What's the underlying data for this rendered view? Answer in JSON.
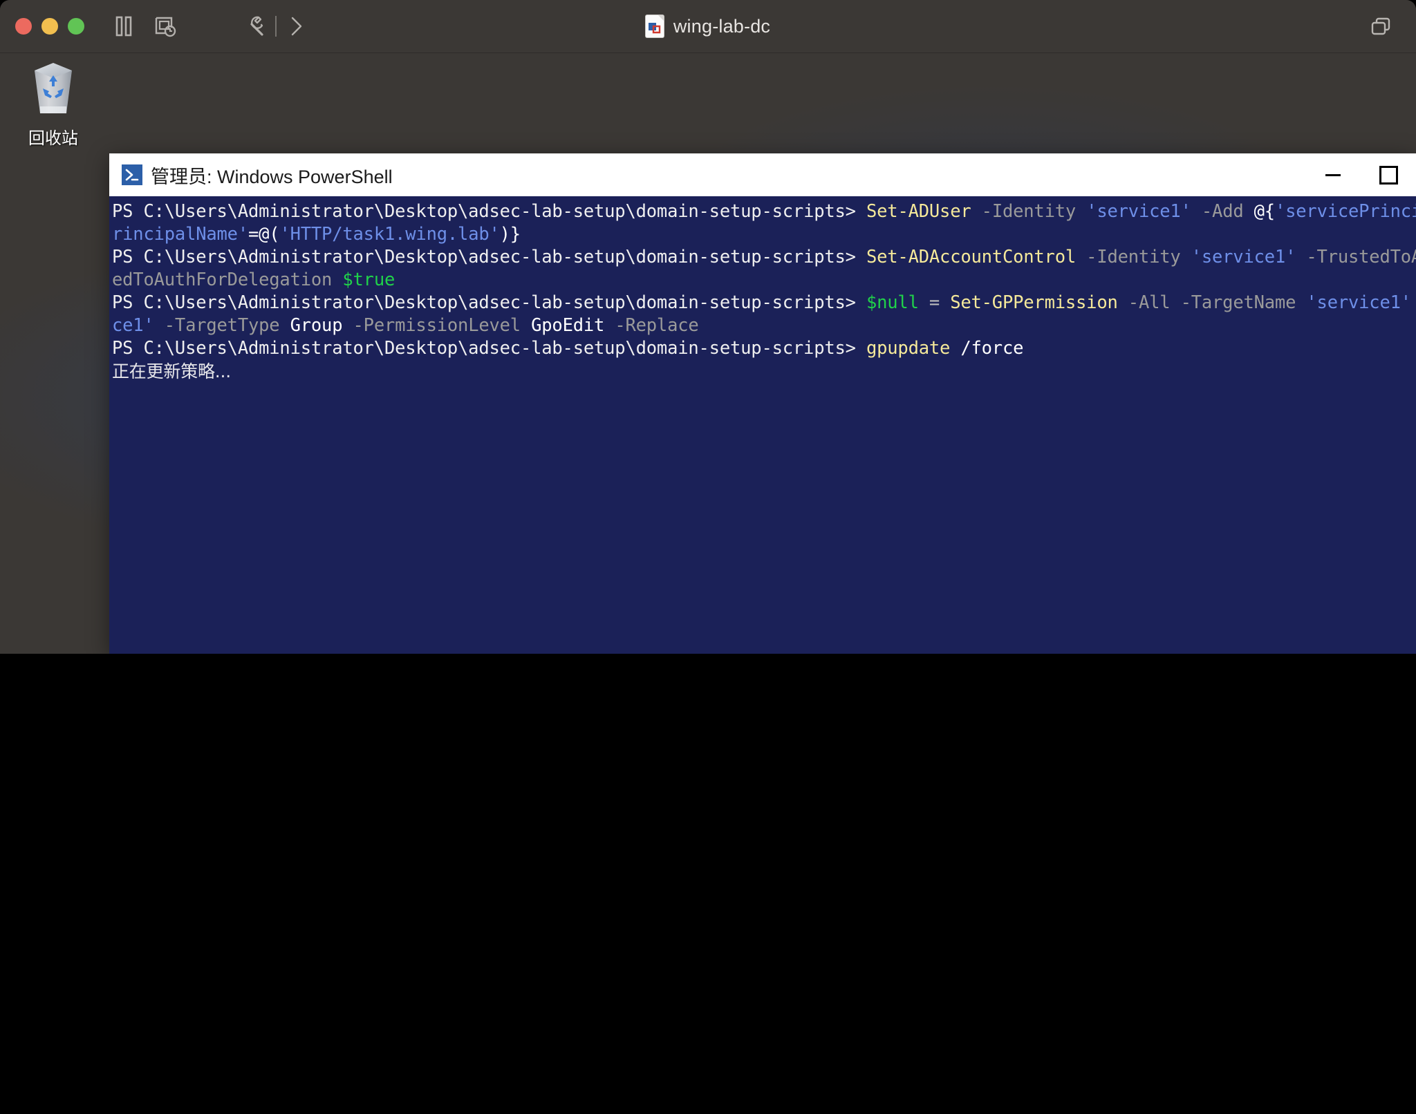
{
  "client": {
    "title": "wing-lab-dc",
    "title_icon": "rdp-file-icon",
    "traffic_lights": [
      "close-button",
      "minimize-button",
      "zoom-button"
    ],
    "toolbar_icons": [
      {
        "name": "pause-icon",
        "label": "Pause"
      },
      {
        "name": "screenshot-clock-icon",
        "label": "Capture"
      },
      {
        "name": "wrench-icon",
        "label": "Tools"
      },
      {
        "name": "chevron-right-icon",
        "label": "Expand"
      }
    ],
    "restore_icon": "restore-windows-icon"
  },
  "desktop": {
    "icons": [
      {
        "name": "recycle-bin",
        "label": "回收站"
      }
    ]
  },
  "powershell": {
    "title": "管理员: Windows PowerShell",
    "icon": "powershell-prompt-icon",
    "controls": {
      "minimize": "minimize-button",
      "maximize": "maximize-button"
    },
    "prompt": "PS C:\\Users\\Administrator\\Desktop\\adsec-lab-setup\\domain-setup-scripts> ",
    "lines": [
      {
        "id": "line-1",
        "segments": [
          {
            "t": "PS C:\\Users\\Administrator\\Desktop\\adsec-lab-setup\\domain-se",
            "c": "tok-path"
          },
          {
            "t": "tup-scripts> ",
            "c": "tok-path"
          },
          {
            "t": "Set-ADUser ",
            "c": "tok-cmdlet"
          },
          {
            "t": "-Identity ",
            "c": "tok-param"
          },
          {
            "t": "'service1'",
            "c": "tok-string"
          },
          {
            "t": " ",
            "c": "tok-plain"
          },
          {
            "t": "-Add ",
            "c": "tok-param"
          },
          {
            "t": "@{",
            "c": "tok-plain"
          },
          {
            "t": "'servicePrincipalName'",
            "c": "tok-string"
          }
        ]
      },
      {
        "id": "line-2",
        "segments": [
          {
            "t": "rincipalName'",
            "c": "tok-string"
          },
          {
            "t": "=@(",
            "c": "tok-plain"
          },
          {
            "t": "'HTTP/task1.wing.lab'",
            "c": "tok-string"
          },
          {
            "t": ")}",
            "c": "tok-plain"
          }
        ]
      },
      {
        "id": "line-3",
        "segments": [
          {
            "t": "PS C:\\Users\\Administrator\\Desktop\\adsec-lab-setup\\domain-setup-scrip",
            "c": "tok-path"
          },
          {
            "t": "ts> ",
            "c": "tok-path"
          },
          {
            "t": "Set-ADAccountControl ",
            "c": "tok-cmdlet"
          },
          {
            "t": "-Identity ",
            "c": "tok-param"
          },
          {
            "t": "'service1'",
            "c": "tok-string"
          },
          {
            "t": " ",
            "c": "tok-plain"
          },
          {
            "t": "-TrustedToAuthForDelegation",
            "c": "tok-param"
          }
        ]
      },
      {
        "id": "line-4",
        "segments": [
          {
            "t": "edToAuthForDelegation ",
            "c": "tok-param"
          },
          {
            "t": "$true",
            "c": "tok-var"
          }
        ]
      },
      {
        "id": "line-5",
        "segments": [
          {
            "t": "PS C:\\Users\\Administrator\\Desktop\\adsec-lab-setup\\domain-setup-scrip",
            "c": "tok-path"
          },
          {
            "t": "ts> ",
            "c": "tok-path"
          },
          {
            "t": "$null",
            "c": "tok-var"
          },
          {
            "t": " = ",
            "c": "tok-op"
          },
          {
            "t": "Set-GPPermission ",
            "c": "tok-cmdlet"
          },
          {
            "t": "-All ",
            "c": "tok-param"
          },
          {
            "t": "-TargetName ",
            "c": "tok-param"
          },
          {
            "t": "'service1'",
            "c": "tok-string"
          }
        ]
      },
      {
        "id": "line-6",
        "segments": [
          {
            "t": "ce1'",
            "c": "tok-string"
          },
          {
            "t": " ",
            "c": "tok-plain"
          },
          {
            "t": "-TargetType ",
            "c": "tok-param"
          },
          {
            "t": "Group ",
            "c": "tok-plain"
          },
          {
            "t": "-PermissionLevel ",
            "c": "tok-param"
          },
          {
            "t": "GpoEdit ",
            "c": "tok-plain"
          },
          {
            "t": "-Replace",
            "c": "tok-param"
          }
        ]
      },
      {
        "id": "line-7",
        "segments": [
          {
            "t": "PS C:\\Users\\Administrator\\Desktop\\adsec-lab-setup\\domain-setup-scrip",
            "c": "tok-path"
          },
          {
            "t": "ts> ",
            "c": "tok-path"
          },
          {
            "t": "gpupdate ",
            "c": "tok-cmdlet"
          },
          {
            "t": "/force",
            "c": "tok-plain"
          }
        ]
      },
      {
        "id": "line-8",
        "cjk": true,
        "segments": [
          {
            "t": "正在更新策略...",
            "c": "tok-out"
          }
        ]
      }
    ]
  },
  "colors": {
    "client_chrome": "#3b3835",
    "desktop_bg": "#13224b",
    "console_bg": "#1b2158",
    "cmdlet": "#f5e99a",
    "param": "#9a9a9a",
    "string": "#6e8fe8",
    "variable": "#20d14a",
    "prompt_text": "#efefef"
  }
}
